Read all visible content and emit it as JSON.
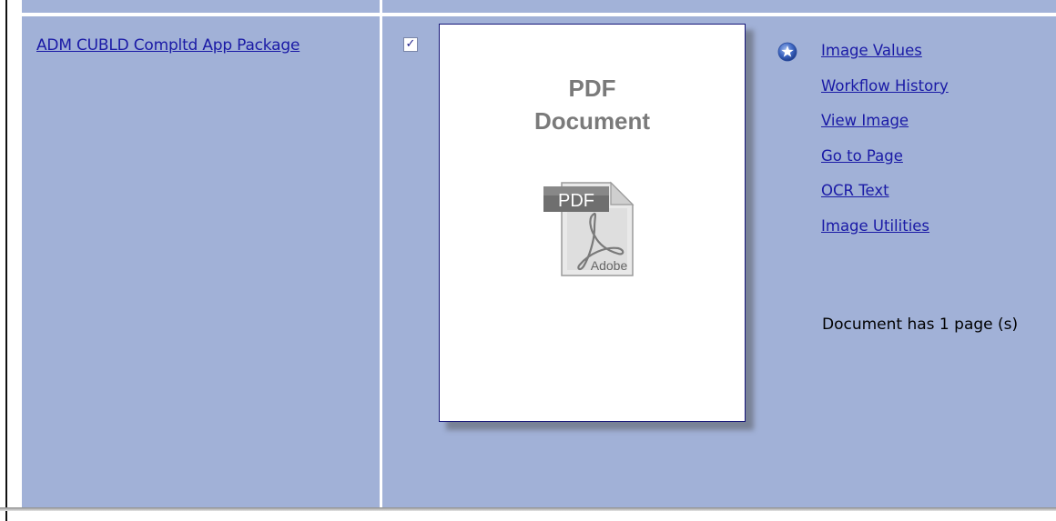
{
  "document": {
    "name": "ADM CUBLD Compltd App Package",
    "selected": true,
    "checkbox_mark": "✓"
  },
  "thumbnail": {
    "line1": "PDF",
    "line2": "Document",
    "icon_name": "pdf-file-icon",
    "icon_label": "PDF",
    "icon_brand": "Adobe"
  },
  "actions": [
    {
      "label": "Image Values"
    },
    {
      "label": "Workflow History"
    },
    {
      "label": "View Image"
    },
    {
      "label": "Go to Page"
    },
    {
      "label": "OCR Text"
    },
    {
      "label": "Image Utilities"
    }
  ],
  "page_info": "Document has 1 page (s)",
  "colors": {
    "row_background": "#a1b1d7",
    "link": "#1a1aa6",
    "thumbnail_border": "#141478"
  }
}
